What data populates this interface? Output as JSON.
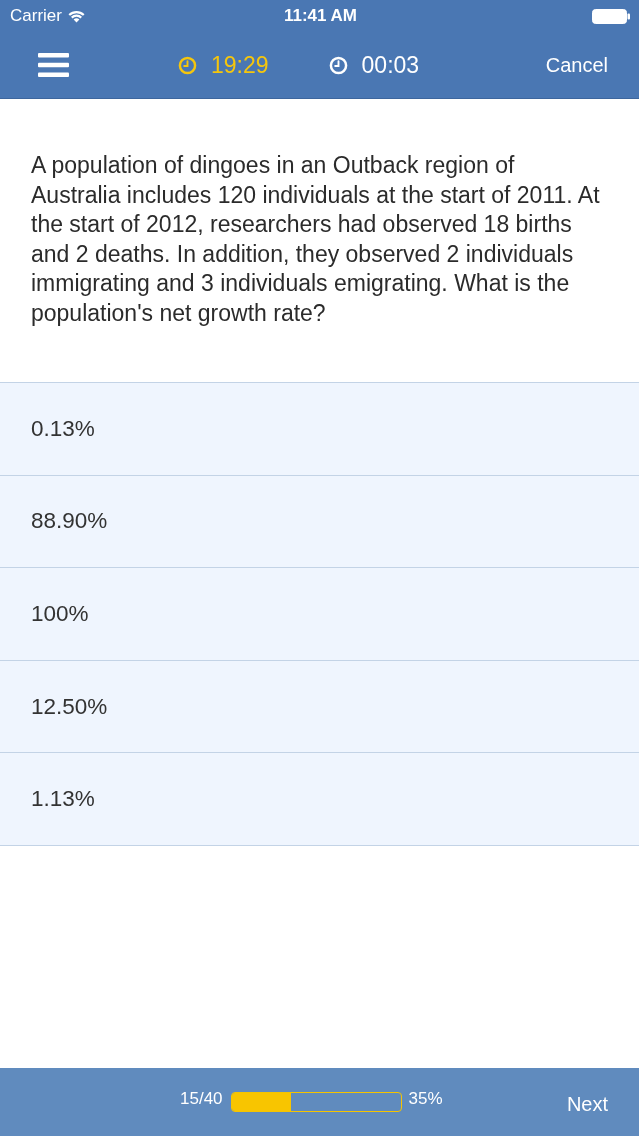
{
  "status_bar": {
    "carrier": "Carrier",
    "time": "11:41 AM"
  },
  "nav_bar": {
    "timers": [
      {
        "kind": "countdown",
        "time": "19:29"
      },
      {
        "kind": "elapsed",
        "time": "00:03"
      }
    ],
    "cancel": "Cancel"
  },
  "question": {
    "text": "A population of dingoes in an Outback region of Australia includes 120 individuals at the start of 2011. At the start of 2012, researchers had observed 18 births and 2 deaths. In addition, they observed 2 individuals immigrating and 3 individuals emigrating. What is the population's net growth rate?"
  },
  "answers": [
    {
      "label": "0.13%",
      "selected": false
    },
    {
      "label": "88.90%",
      "selected": false
    },
    {
      "label": "100%",
      "selected": false
    },
    {
      "label": "12.50%",
      "selected": false
    },
    {
      "label": "1.13%",
      "selected": false
    }
  ],
  "footer": {
    "counter": "15/40",
    "progress": {
      "level": 0.35
    },
    "percent": "35%",
    "next": "Next"
  }
}
